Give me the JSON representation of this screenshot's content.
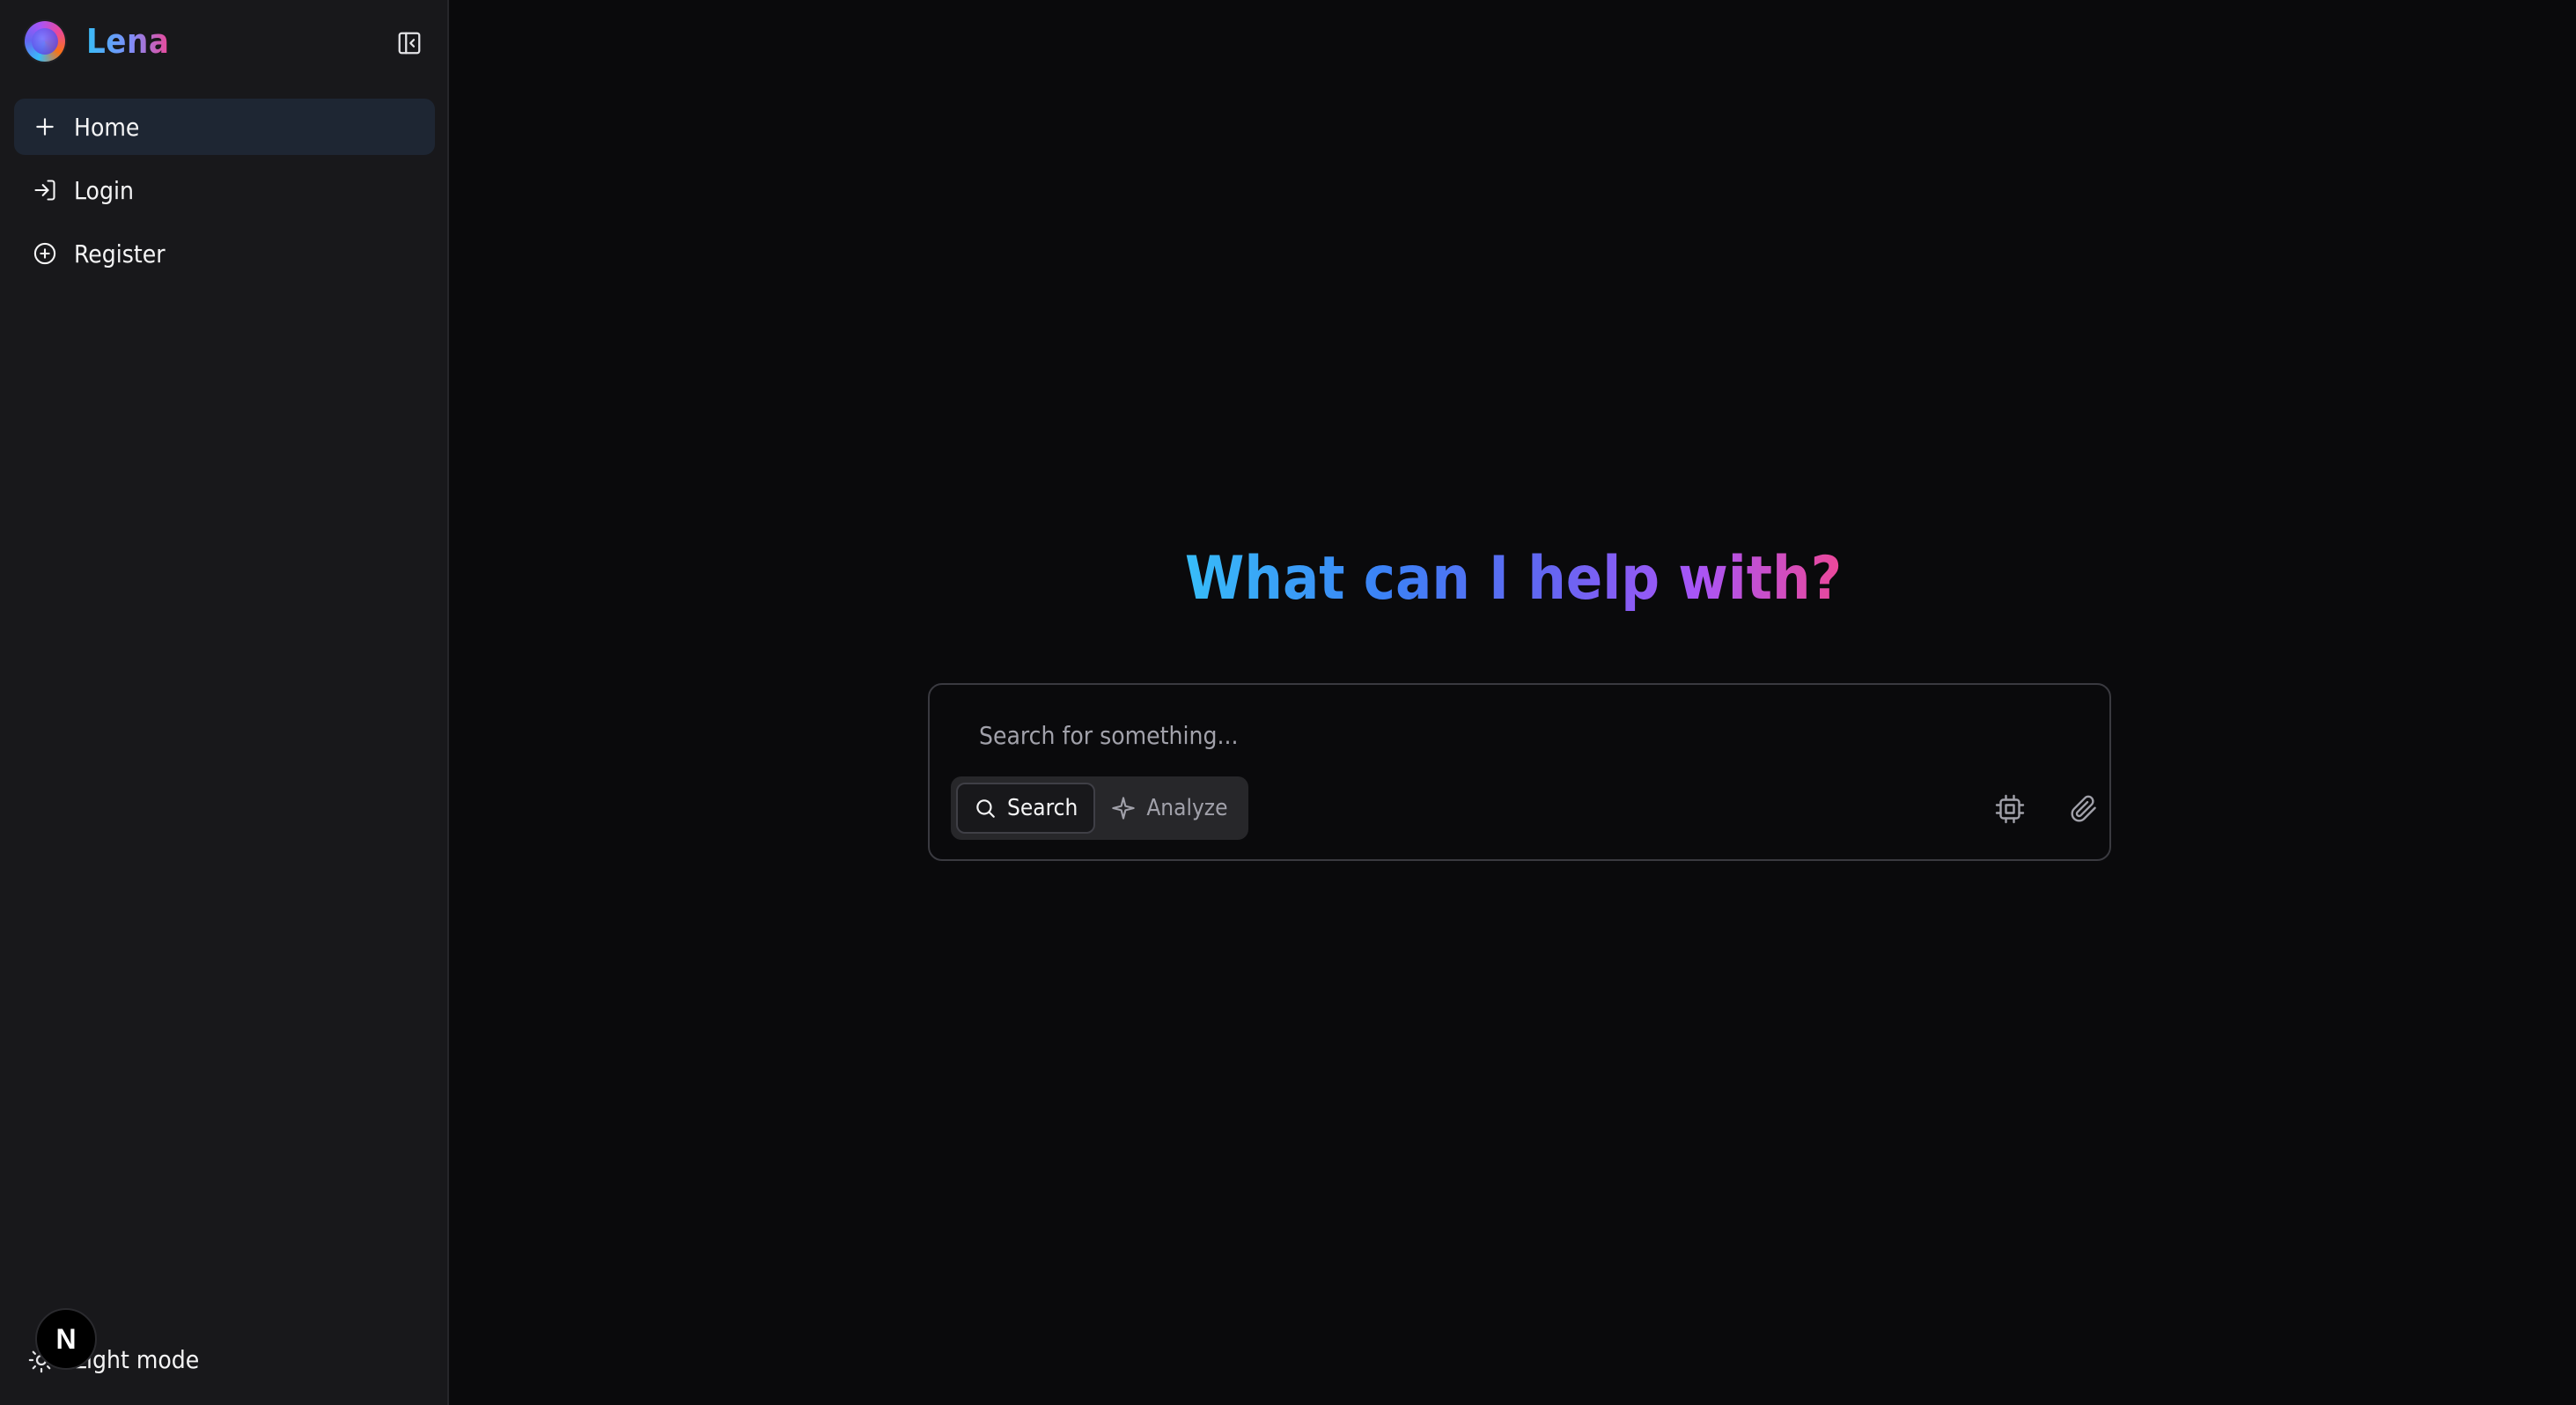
{
  "app": {
    "name": "Lena"
  },
  "sidebar": {
    "items": [
      {
        "label": "Home",
        "icon": "plus-icon",
        "active": true
      },
      {
        "label": "Login",
        "icon": "login-icon",
        "active": false
      },
      {
        "label": "Register",
        "icon": "plus-circle-icon",
        "active": false
      }
    ],
    "theme_toggle_label": "Light mode",
    "badge_letter": "N"
  },
  "main": {
    "heading": "What can I help with?",
    "search": {
      "placeholder": "Search for something...",
      "value": ""
    },
    "modes": [
      {
        "label": "Search",
        "icon": "search-icon",
        "active": true
      },
      {
        "label": "Analyze",
        "icon": "sparkle-icon",
        "active": false
      }
    ],
    "tools": [
      {
        "name": "cpu-icon"
      },
      {
        "name": "paperclip-icon"
      }
    ]
  },
  "colors": {
    "background": "#0a0a0c",
    "sidebar": "#18181b",
    "active_item": "#1e2633",
    "gradient": [
      "#38bdf8",
      "#6366f1",
      "#a855f7",
      "#ec4899"
    ]
  }
}
